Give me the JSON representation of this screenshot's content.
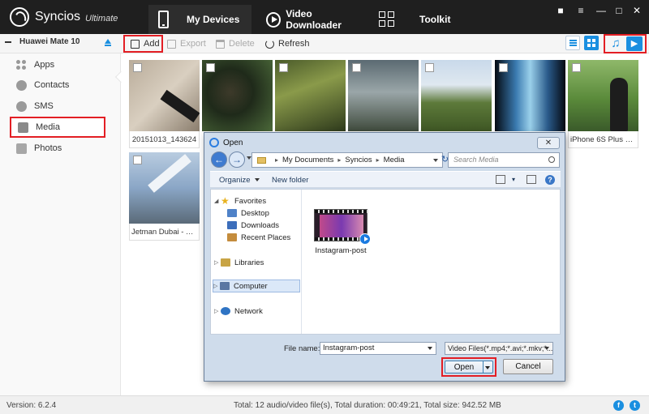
{
  "app": {
    "name": "Syncios",
    "edition": "Ultimate",
    "accent_color": "#1a8fe0",
    "highlight_color": "#e31e24"
  },
  "nav": {
    "my_devices": "My Devices",
    "video_downloader": "Video Downloader",
    "toolkit": "Toolkit"
  },
  "window_controls": {
    "message": "message-icon",
    "menu": "menu-icon",
    "minimize": "minimize-icon",
    "maximize": "maximize-icon",
    "close": "close-icon"
  },
  "toolbar": {
    "device_name": "Huawei Mate 10",
    "add": "Add",
    "export": "Export",
    "delete": "Delete",
    "refresh": "Refresh"
  },
  "sidebar": {
    "items": [
      {
        "label": "Apps",
        "icon": "apps-icon"
      },
      {
        "label": "Contacts",
        "icon": "contacts-icon"
      },
      {
        "label": "SMS",
        "icon": "sms-icon"
      },
      {
        "label": "Media",
        "icon": "media-icon",
        "active": true
      },
      {
        "label": "Photos",
        "icon": "photos-icon"
      }
    ]
  },
  "media_grid": {
    "items": [
      {
        "caption": "20151013_143624"
      },
      {
        "caption": ""
      },
      {
        "caption": ""
      },
      {
        "caption": ""
      },
      {
        "caption": ""
      },
      {
        "caption": ""
      },
      {
        "caption": "iPhone 6S Plus Came..."
      },
      {
        "caption": "Jetman Dubai  - You..."
      }
    ]
  },
  "status": {
    "version": "Version: 6.2.4",
    "totals": "Total: 12 audio/video file(s), Total duration: 00:49:21, Total size: 942.52 MB"
  },
  "dialog": {
    "title": "Open",
    "breadcrumb": [
      "My Documents",
      "Syncios",
      "Media"
    ],
    "search_placeholder": "Search Media",
    "organize": "Organize",
    "new_folder": "New folder",
    "tree": {
      "favorites": "Favorites",
      "desktop": "Desktop",
      "downloads": "Downloads",
      "recent_places": "Recent Places",
      "libraries": "Libraries",
      "computer": "Computer",
      "network": "Network"
    },
    "file": {
      "name": "Instagram-post"
    },
    "file_name_label": "File name:",
    "file_name_value": "Instagram-post",
    "file_type_value": "Video Files(*.mp4;*.avi;*.mkv;*...",
    "open_button": "Open",
    "cancel_button": "Cancel"
  }
}
